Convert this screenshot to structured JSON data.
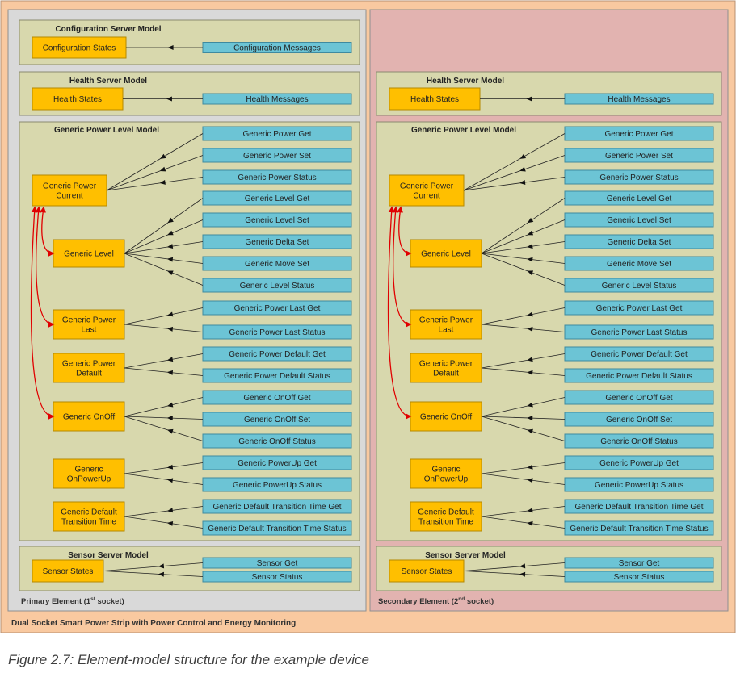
{
  "colors": {
    "outer_bg": "#f9c9a0",
    "primary_bg": "#d9d9d9",
    "secondary_bg": "#e2b3b0",
    "model_bg": "#d8d8ad",
    "state_fill": "#ffbf00",
    "state_stroke": "#b58900",
    "message_fill": "#6cc4d5",
    "message_stroke": "#3e8aa0",
    "binding_arrow": "#e00000",
    "line": "#222222"
  },
  "device_title": "Dual Socket Smart Power Strip with Power Control and Energy Monitoring",
  "caption": "Figure 2.7: Element-model structure for the example device",
  "elements": [
    {
      "label_prefix": "Primary Element (1",
      "label_sup": "st",
      "label_suffix": " socket)",
      "has_config": true
    },
    {
      "label_prefix": "Secondary Element (2",
      "label_sup": "nd",
      "label_suffix": " socket)",
      "has_config": false
    }
  ],
  "config_model": {
    "title": "Configuration Server Model",
    "state": "Configuration States",
    "messages": [
      "Configuration Messages"
    ]
  },
  "health_model": {
    "title": "Health Server Model",
    "state": "Health States",
    "messages": [
      "Health Messages"
    ]
  },
  "generic_power_level_model": {
    "title": "Generic Power Level Model",
    "states": [
      {
        "id": "power_current",
        "lines": [
          "Generic Power",
          "Current"
        ],
        "messages": [
          "Generic Power Get",
          "Generic Power Set",
          "Generic Power Status"
        ]
      },
      {
        "id": "level",
        "lines": [
          "Generic Level"
        ],
        "messages": [
          "Generic Level Get",
          "Generic Level Set",
          "Generic Delta Set",
          "Generic Move Set",
          "Generic Level Status"
        ]
      },
      {
        "id": "power_last",
        "lines": [
          "Generic Power",
          "Last"
        ],
        "messages": [
          "Generic Power Last Get",
          "Generic Power Last Status"
        ]
      },
      {
        "id": "power_default",
        "lines": [
          "Generic Power",
          "Default"
        ],
        "messages": [
          "Generic Power Default Get",
          "Generic Power Default Status"
        ]
      },
      {
        "id": "onoff",
        "lines": [
          "Generic OnOff"
        ],
        "messages": [
          "Generic OnOff Get",
          "Generic OnOff Set",
          "Generic OnOff Status"
        ]
      },
      {
        "id": "onpowerup",
        "lines": [
          "Generic",
          "OnPowerUp"
        ],
        "messages": [
          "Generic PowerUp Get",
          "Generic PowerUp Status"
        ]
      },
      {
        "id": "default_transition",
        "lines": [
          "Generic Default",
          "Transition Time"
        ],
        "messages": [
          "Generic Default Transition Time Get",
          "Generic Default Transition Time Status"
        ]
      }
    ]
  },
  "sensor_model": {
    "title": "Sensor Server Model",
    "state": "Sensor States",
    "messages": [
      "Sensor Get",
      "Sensor Status"
    ]
  }
}
